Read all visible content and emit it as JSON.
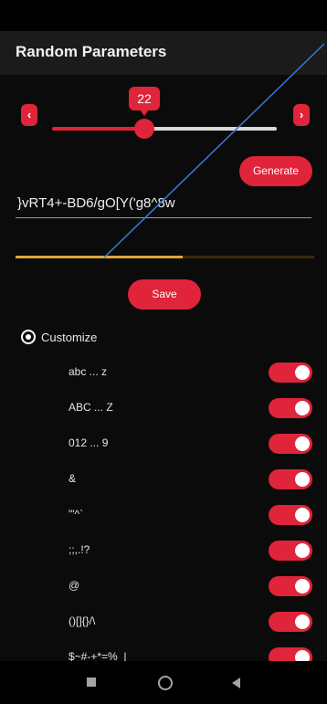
{
  "app": {
    "title": "Random Parameters"
  },
  "length": {
    "value": "22",
    "fraction": 0.4
  },
  "buttons": {
    "prev": "‹",
    "next": "›",
    "generate": "Generate",
    "save": "Save"
  },
  "password": {
    "value": "}vRT4+-BD6/gO[Y('g8^8w"
  },
  "strength": {
    "fraction": 0.56
  },
  "customize": {
    "label": "Customize"
  },
  "options": [
    {
      "label": "abc ... z",
      "enabled": true
    },
    {
      "label": "ABC ... Z",
      "enabled": true
    },
    {
      "label": "012 ... 9",
      "enabled": true
    },
    {
      "label": "&",
      "enabled": true
    },
    {
      "label": "\"'^`",
      "enabled": true
    },
    {
      "label": ";;,.!?",
      "enabled": true
    },
    {
      "label": "@",
      "enabled": true
    },
    {
      "label": "()[]{}/\\",
      "enabled": true
    },
    {
      "label": "$~#-+*=%_|",
      "enabled": true
    }
  ],
  "colors": {
    "accent": "#e0243a",
    "strength": "#e0a83a"
  }
}
